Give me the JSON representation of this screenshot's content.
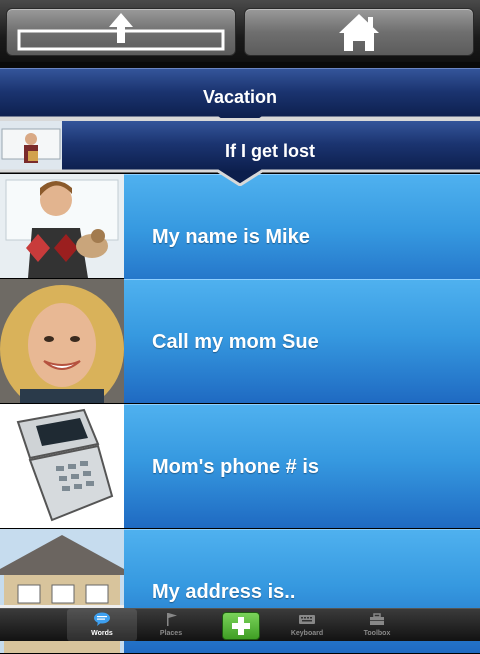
{
  "toolbar": {
    "up_icon": "arrow-up-icon",
    "home_icon": "home-icon"
  },
  "headers": {
    "category": "Vacation",
    "subcategory": "If I get lost"
  },
  "phrases": [
    {
      "label": "My name is Mike",
      "photo": "boy-with-dog-photo"
    },
    {
      "label": "Call my mom Sue",
      "photo": "woman-portrait-photo"
    },
    {
      "label": "Mom's phone # is",
      "photo": "flip-phone-photo"
    },
    {
      "label": "My address is..",
      "photo": "house-photo"
    }
  ],
  "tabs": [
    {
      "label": "Words",
      "icon": "speech-bubble-icon"
    },
    {
      "label": "Places",
      "icon": "flag-icon"
    },
    {
      "label": "",
      "icon": "plus-icon"
    },
    {
      "label": "Keyboard",
      "icon": "keyboard-icon"
    },
    {
      "label": "Toolbox",
      "icon": "toolbox-icon"
    }
  ],
  "colors": {
    "header_navy": "#1b3470",
    "phrase_blue": "#3699e0",
    "add_green": "#3f9e24"
  }
}
